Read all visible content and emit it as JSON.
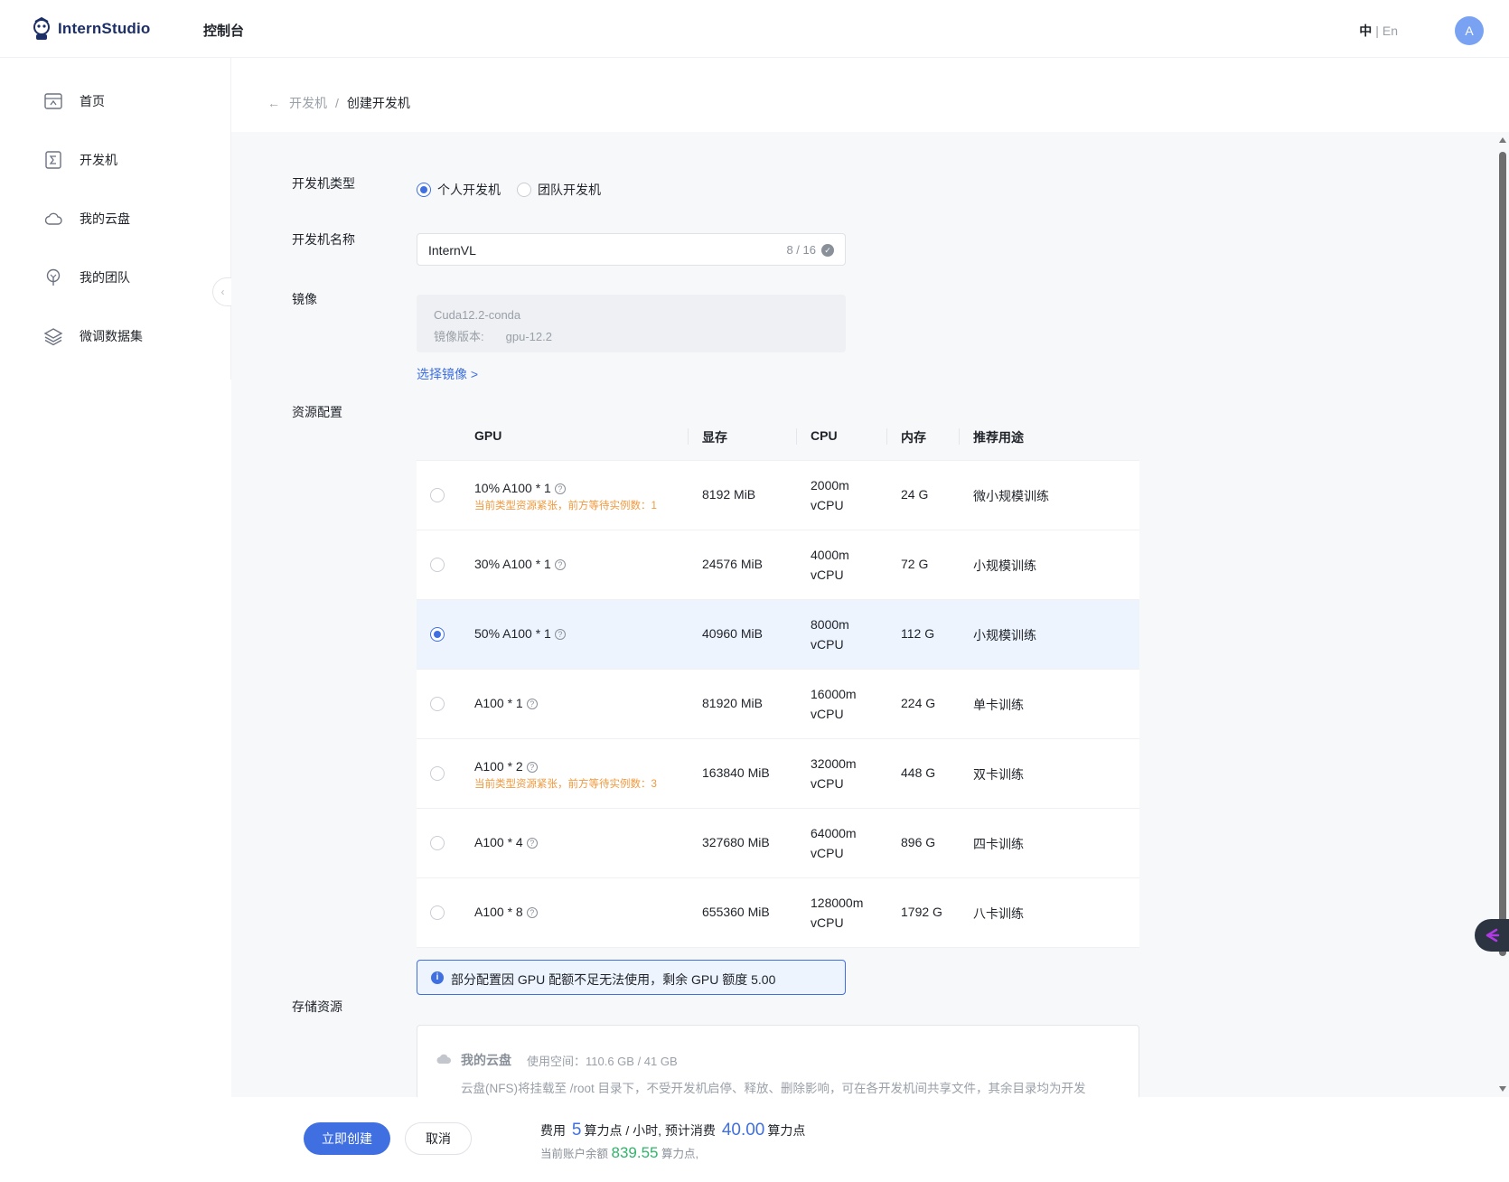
{
  "header": {
    "logo_text": "InternStudio",
    "title": "控制台",
    "lang_zh": "中",
    "lang_sep": "|",
    "lang_en": "En",
    "avatar_letter": "A"
  },
  "sidebar": {
    "items": [
      {
        "label": "首页",
        "icon": "home-icon"
      },
      {
        "label": "开发机",
        "icon": "sigma-icon"
      },
      {
        "label": "我的云盘",
        "icon": "cloud-icon"
      },
      {
        "label": "我的团队",
        "icon": "team-icon"
      },
      {
        "label": "微调数据集",
        "icon": "layers-icon"
      }
    ],
    "collapse_glyph": "‹"
  },
  "breadcrumb": {
    "back_glyph": "←",
    "parent": "开发机",
    "separator": "/",
    "current": "创建开发机"
  },
  "form": {
    "type_label": "开发机类型",
    "type_options": [
      {
        "label": "个人开发机",
        "checked": true
      },
      {
        "label": "团队开发机",
        "checked": false
      }
    ],
    "name_label": "开发机名称",
    "name_value": "InternVL",
    "name_count": "8 / 16",
    "image_label": "镜像",
    "image_name": "Cuda12.2-conda",
    "image_version_label": "镜像版本:",
    "image_version": "gpu-12.2",
    "select_image": "选择镜像 >",
    "resource_label": "资源配置",
    "storage_label": "存储资源"
  },
  "resource_table": {
    "headers": [
      "GPU",
      "显存",
      "CPU",
      "内存",
      "推荐用途"
    ],
    "rows": [
      {
        "gpu": "10% A100 * 1",
        "warning": "当前类型资源紧张，前方等待实例数：1",
        "vram": "8192 MiB",
        "cpu1": "2000m",
        "cpu2": "vCPU",
        "mem": "24 G",
        "use": "微小规模训练",
        "selected": false
      },
      {
        "gpu": "30% A100 * 1",
        "warning": "",
        "vram": "24576 MiB",
        "cpu1": "4000m",
        "cpu2": "vCPU",
        "mem": "72 G",
        "use": "小规模训练",
        "selected": false
      },
      {
        "gpu": "50% A100 * 1",
        "warning": "",
        "vram": "40960 MiB",
        "cpu1": "8000m",
        "cpu2": "vCPU",
        "mem": "112 G",
        "use": "小规模训练",
        "selected": true
      },
      {
        "gpu": "A100 * 1",
        "warning": "",
        "vram": "81920 MiB",
        "cpu1": "16000m",
        "cpu2": "vCPU",
        "mem": "224 G",
        "use": "单卡训练",
        "selected": false
      },
      {
        "gpu": "A100 * 2",
        "warning": "当前类型资源紧张，前方等待实例数：3",
        "vram": "163840 MiB",
        "cpu1": "32000m",
        "cpu2": "vCPU",
        "mem": "448 G",
        "use": "双卡训练",
        "selected": false
      },
      {
        "gpu": "A100 * 4",
        "warning": "",
        "vram": "327680 MiB",
        "cpu1": "64000m",
        "cpu2": "vCPU",
        "mem": "896 G",
        "use": "四卡训练",
        "selected": false
      },
      {
        "gpu": "A100 * 8",
        "warning": "",
        "vram": "655360 MiB",
        "cpu1": "128000m",
        "cpu2": "vCPU",
        "mem": "1792 G",
        "use": "八卡训练",
        "selected": false
      }
    ]
  },
  "alert": {
    "text": "部分配置因 GPU 配额不足无法使用，剩余 GPU 额度 5.00"
  },
  "storage": {
    "name": "我的云盘",
    "usage": "使用空间：110.6 GB / 41 GB",
    "desc": "云盘(NFS)将挂载至 /root 目录下，不受开发机启停、释放、删除影响，可在各开发机间共享文件，其余目录均为开发"
  },
  "footer": {
    "create_button": "立即创建",
    "cancel_button": "取消",
    "fee_prefix": "费用",
    "fee_rate": "5",
    "fee_mid": "算力点 / 小时, 预计消费",
    "fee_total": "40.00",
    "fee_suffix": "算力点",
    "balance_prefix": "当前账户余额",
    "balance_value": "839.55",
    "balance_suffix": "算力点,"
  },
  "colors": {
    "primary": "#3f6fe0",
    "warning": "#f0993e",
    "success": "#33b36b",
    "selected_row": "#eef4fe"
  }
}
